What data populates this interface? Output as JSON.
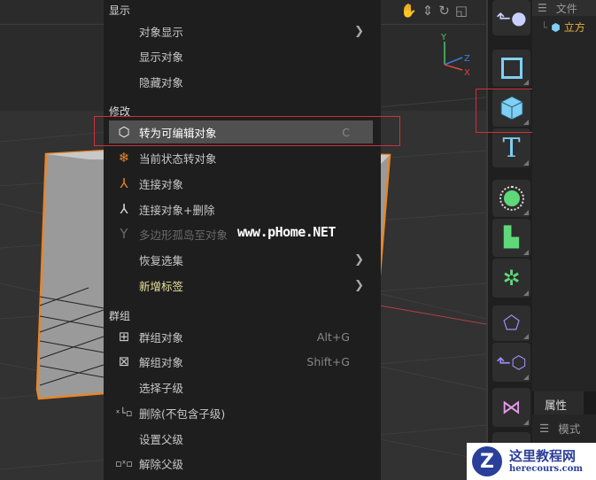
{
  "menu": {
    "sections": {
      "display": "显示",
      "modify": "修改",
      "group": "群组"
    },
    "items": [
      {
        "label": "对象显示",
        "submenu": true
      },
      {
        "label": "显示对象"
      },
      {
        "label": "隐藏对象"
      },
      {
        "label": "转为可编辑对象",
        "shortcut": "C",
        "icon": "make-editable-icon",
        "highlighted": true
      },
      {
        "label": "当前状态转对象",
        "icon": "snowflake-icon"
      },
      {
        "label": "连接对象",
        "icon": "connect-icon"
      },
      {
        "label": "连接对象+删除",
        "icon": "connect-delete-icon"
      },
      {
        "label": "多边形孤岛至对象",
        "icon": "polygon-island-icon",
        "disabled": true
      },
      {
        "label": "恢复选集",
        "submenu": true
      },
      {
        "label": "新增标签",
        "submenu": true
      },
      {
        "label": "群组对象",
        "shortcut": "Alt+G",
        "icon": "group-icon"
      },
      {
        "label": "解组对象",
        "shortcut": "Shift+G",
        "icon": "ungroup-icon"
      },
      {
        "label": "选择子级"
      },
      {
        "label": "删除(不包含子级)",
        "icon": "delete-without-children-icon"
      },
      {
        "label": "设置父级"
      },
      {
        "label": "解除父级",
        "icon": "unparent-icon"
      }
    ]
  },
  "watermark": "www.pHome.NET",
  "axis": {
    "y": "Y",
    "z": "Z",
    "x": "X"
  },
  "panel": {
    "top_tab": "文件",
    "tree_item": "立方",
    "attr_tab": "属性",
    "mode_label": "模式"
  },
  "logo": {
    "title": "这里教程网",
    "url": "herecours.com"
  },
  "colors": {
    "accent": "#e8862a",
    "highlight_box": "#d0303a",
    "tool_blue": "#7fd0f5",
    "tool_green": "#5fd87a",
    "tool_purple": "#9a8cf0"
  }
}
